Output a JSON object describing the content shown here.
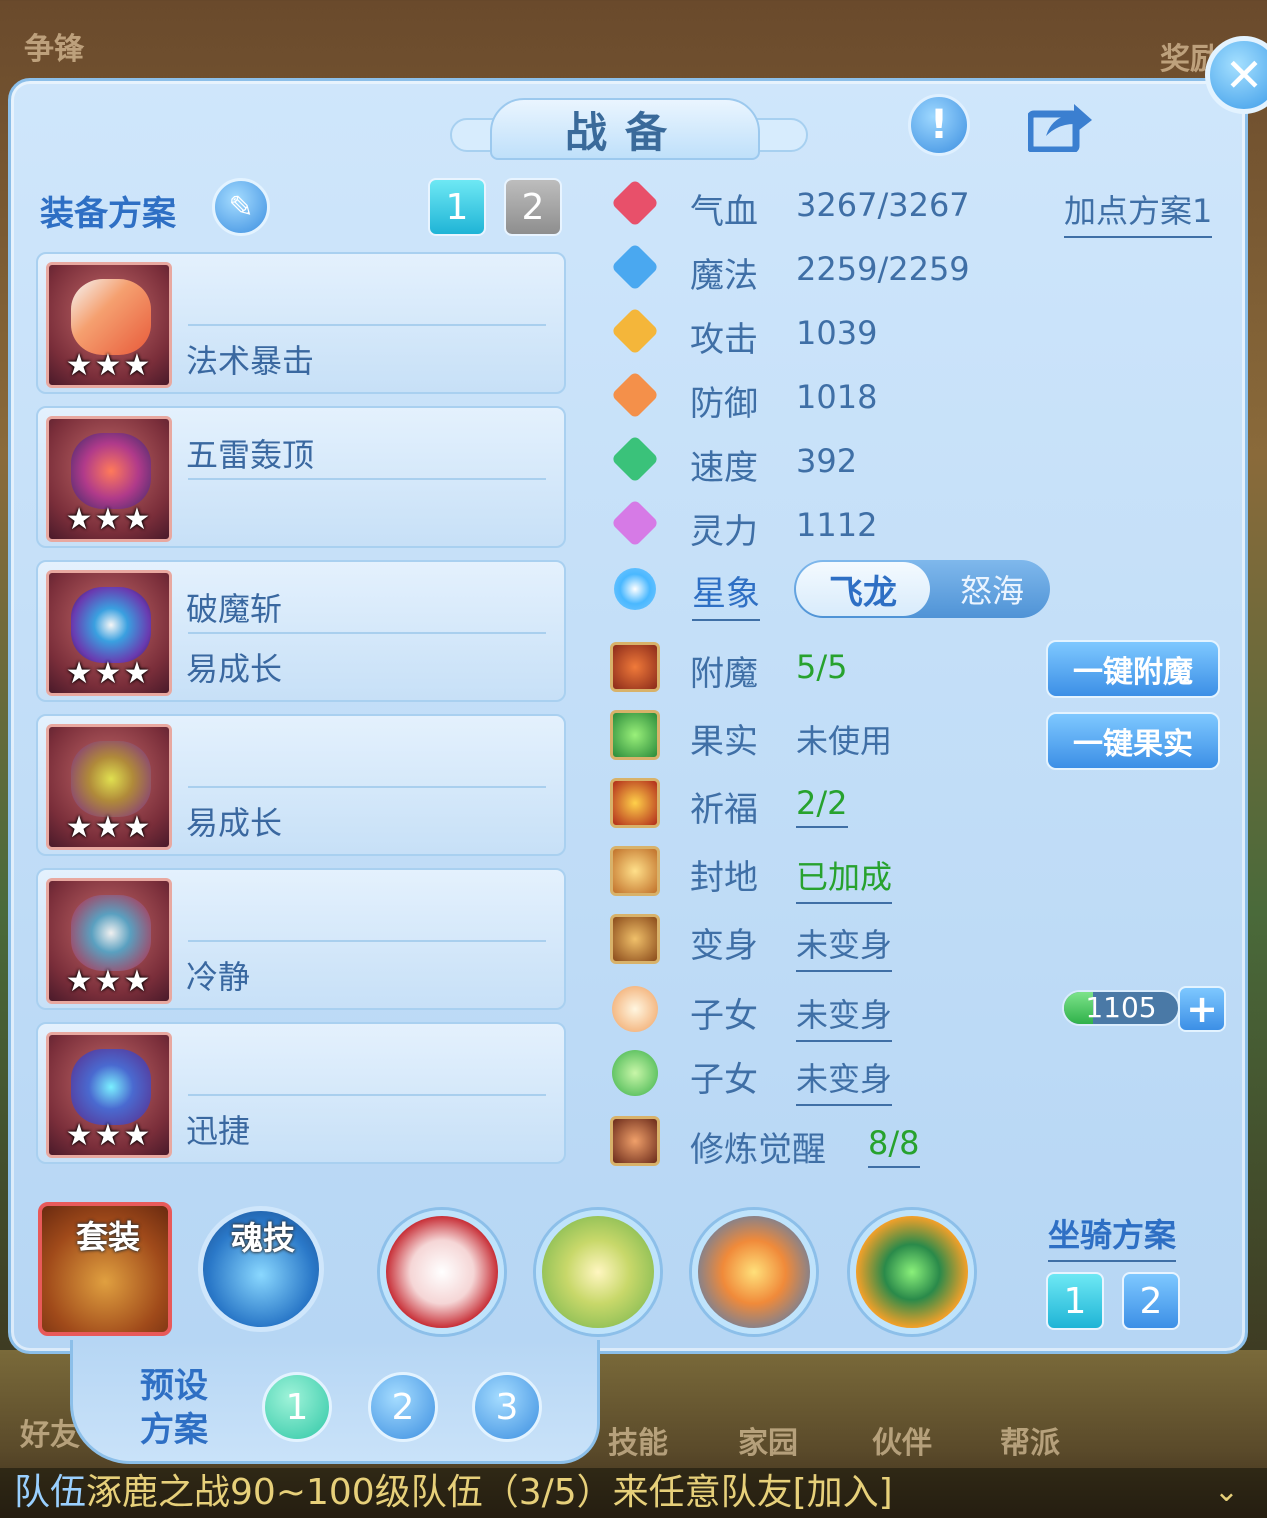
{
  "background": {
    "top_left": "争锋",
    "top_right": "奖励",
    "bottom_menu": [
      "好友",
      "技能",
      "家园",
      "伙伴",
      "帮派"
    ],
    "chat": {
      "channel": "队伍",
      "message": "涿鹿之战90~100级队伍（3/5）来任意队友[加入]"
    }
  },
  "panel": {
    "title": "战备"
  },
  "equip_scheme": {
    "label": "装备方案",
    "tabs": [
      "1",
      "2"
    ],
    "active_tab": "1",
    "items": [
      {
        "icon": "ice-candy-icon",
        "line1": "",
        "line2": "法术暴击",
        "stars": "★★★"
      },
      {
        "icon": "helmet-icon",
        "line1": "五雷轰顶",
        "line2": "",
        "stars": "★★★"
      },
      {
        "icon": "armor-icon",
        "line1": "破魔斩",
        "line2": "易成长",
        "stars": "★★★"
      },
      {
        "icon": "necklace-icon",
        "line1": "",
        "line2": "易成长",
        "stars": "★★★"
      },
      {
        "icon": "belt-icon",
        "line1": "",
        "line2": "冷静",
        "stars": "★★★"
      },
      {
        "icon": "boots-icon",
        "line1": "",
        "line2": "迅捷",
        "stars": "★★★"
      }
    ]
  },
  "stats": {
    "plan_link": "加点方案1",
    "rows": [
      {
        "label": "气血",
        "value": "3267/3267",
        "color": "#e8506a"
      },
      {
        "label": "魔法",
        "value": "2259/2259",
        "color": "#4aa8f0"
      },
      {
        "label": "攻击",
        "value": "1039",
        "color": "#f4b63a"
      },
      {
        "label": "防御",
        "value": "1018",
        "color": "#f4904a"
      },
      {
        "label": "速度",
        "value": "392",
        "color": "#3ac27a"
      },
      {
        "label": "灵力",
        "value": "1112",
        "color": "#d67ae6"
      }
    ],
    "constellation": {
      "label": "星象",
      "options": [
        "飞龙",
        "怒海"
      ],
      "selected": "飞龙"
    }
  },
  "buffs": {
    "enchant": {
      "label": "附魔",
      "value": "5/5",
      "button": "一键附魔"
    },
    "fruit": {
      "label": "果实",
      "value": "未使用",
      "button": "一键果实"
    },
    "blessing": {
      "label": "祈福",
      "value": "2/2"
    },
    "fief": {
      "label": "封地",
      "value": "已加成"
    },
    "transform": {
      "label": "变身",
      "value": "未变身"
    },
    "child1": {
      "label": "子女",
      "value": "未变身",
      "exp_value": "1105",
      "exp_fill": 0.25
    },
    "child2": {
      "label": "子女",
      "value": "未变身"
    },
    "awaken": {
      "label": "修炼觉醒",
      "value": "8/8"
    }
  },
  "bottom": {
    "suit_label": "套装",
    "soul_label": "魂技",
    "skills": [
      "red-swirl-skill",
      "golden-warrior-skill",
      "wave-skill",
      "green-flame-skill"
    ],
    "mount_scheme": {
      "label": "坐骑方案",
      "tabs": [
        "1",
        "2"
      ]
    },
    "preset": {
      "label_line1": "预设",
      "label_line2": "方案",
      "options": [
        "1",
        "2",
        "3"
      ],
      "active": "1"
    }
  }
}
